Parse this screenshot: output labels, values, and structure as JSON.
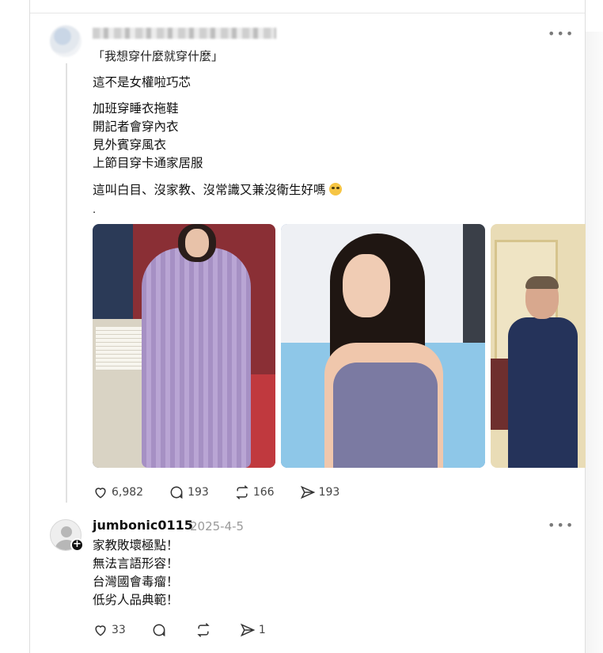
{
  "post": {
    "quote": "「我想穿什麼就穿什麼」",
    "lines": [
      "這不是女權啦巧芯",
      "加班穿睡衣拖鞋",
      "開記者會穿內衣",
      "見外賓穿風衣",
      "上節目穿卡通家居服",
      "這叫白目、沒家教、沒常識又兼沒衛生好嗎",
      "."
    ],
    "emoji": "eye-roll-emoji",
    "images": [
      {
        "icon": "photo-purple-knit-dress"
      },
      {
        "icon": "photo-sleeveless-top"
      },
      {
        "icon": "photo-man-in-suit"
      }
    ],
    "actions": {
      "likes": "6,982",
      "replies": "193",
      "reposts": "166",
      "shares": "193"
    }
  },
  "reply": {
    "username": "jumbonic0115",
    "date": "2025-4-5",
    "lines": [
      "家教敗壞極點！",
      "無法言語形容！",
      "台灣國會毒瘤！",
      "低劣人品典範！"
    ],
    "actions": {
      "likes": "33",
      "replies": "",
      "reposts": "",
      "shares": "1"
    }
  },
  "icons": {
    "more": "more-horizontal-icon",
    "like": "heart-icon",
    "reply": "comment-bubble-icon",
    "repost": "repost-icon",
    "share": "send-icon",
    "follow": "plus-follow-icon"
  },
  "colors": {
    "text": "#101010",
    "muted": "#9a9a9a",
    "border": "#dedede"
  }
}
